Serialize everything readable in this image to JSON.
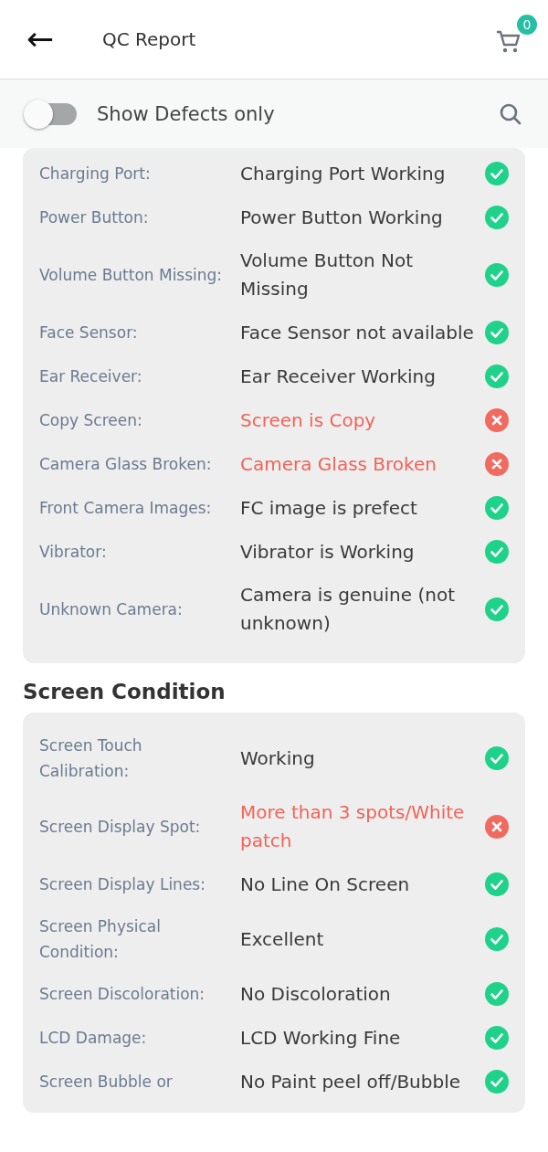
{
  "header": {
    "back": "←",
    "title": "QC Report",
    "cart_count": "0"
  },
  "filter": {
    "label": "Show Defects only",
    "on": false
  },
  "sections": [
    {
      "rows": [
        {
          "label": "Charging Port:",
          "value": "Charging Port Working",
          "ok": true
        },
        {
          "label": "Power Button:",
          "value": "Power Button Working",
          "ok": true
        },
        {
          "label": "Volume Button Missing:",
          "value": "Volume Button Not Missing",
          "ok": true
        },
        {
          "label": "Face Sensor:",
          "value": "Face Sensor not available",
          "ok": true
        },
        {
          "label": "Ear Receiver:",
          "value": "Ear Receiver Working",
          "ok": true
        },
        {
          "label": "Copy Screen:",
          "value": "Screen is Copy",
          "ok": false
        },
        {
          "label": "Camera Glass Broken:",
          "value": "Camera Glass Broken",
          "ok": false
        },
        {
          "label": "Front Camera Images:",
          "value": "FC image is prefect",
          "ok": true
        },
        {
          "label": "Vibrator:",
          "value": "Vibrator is Working",
          "ok": true
        },
        {
          "label": "Unknown Camera:",
          "value": "Camera is genuine (not unknown)",
          "ok": true
        }
      ]
    },
    {
      "title": "Screen Condition",
      "rows": [
        {
          "label": "Screen Touch Calibration:",
          "value": "Working",
          "ok": true
        },
        {
          "label": "Screen Display Spot:",
          "value": "More than 3 spots/White patch",
          "ok": false
        },
        {
          "label": "Screen Display Lines:",
          "value": "No Line On Screen",
          "ok": true
        },
        {
          "label": "Screen Physical Condition:",
          "value": "Excellent",
          "ok": true
        },
        {
          "label": "Screen Discoloration:",
          "value": "No Discoloration",
          "ok": true
        },
        {
          "label": "LCD Damage:",
          "value": "LCD Working Fine",
          "ok": true
        },
        {
          "label": "Screen Bubble or",
          "value": "No Paint peel off/Bubble",
          "ok": true
        }
      ]
    }
  ]
}
